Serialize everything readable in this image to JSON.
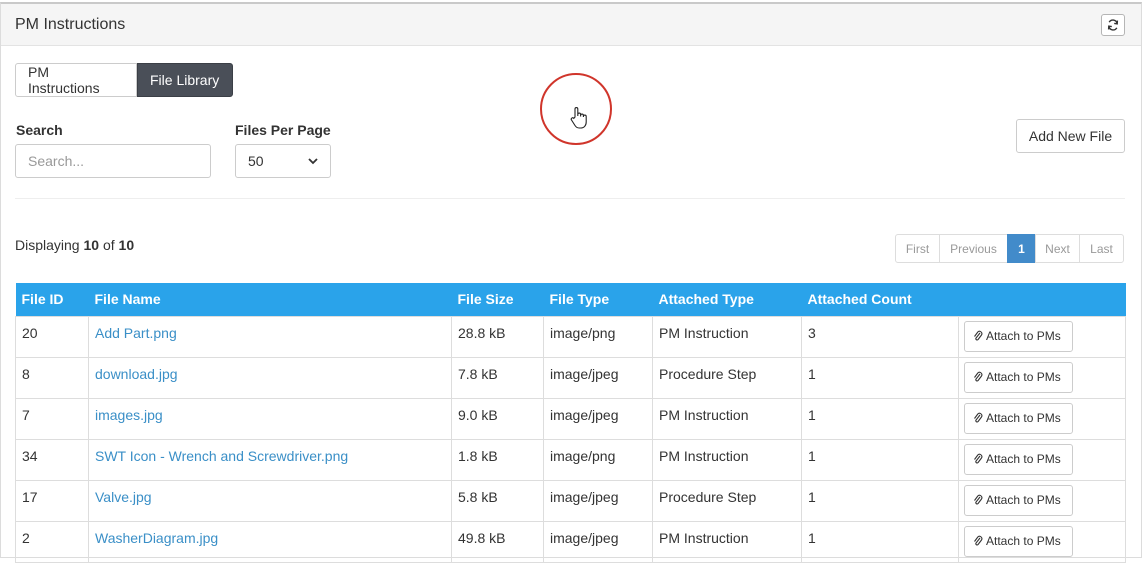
{
  "panel": {
    "title": "PM Instructions",
    "refresh_icon": "refresh-icon"
  },
  "tabs": [
    {
      "label": "PM Instructions",
      "active": false
    },
    {
      "label": "File Library",
      "active": true
    }
  ],
  "search": {
    "label": "Search",
    "placeholder": "Search...",
    "value": ""
  },
  "files_per_page": {
    "label": "Files Per Page",
    "selected": "50"
  },
  "add_new_file_label": "Add New File",
  "displaying": {
    "prefix": "Displaying",
    "shown": "10",
    "of": "of",
    "total": "10"
  },
  "pagination": {
    "first": "First",
    "previous": "Previous",
    "current": "1",
    "next": "Next",
    "last": "Last"
  },
  "table": {
    "columns": [
      "File ID",
      "File Name",
      "File Size",
      "File Type",
      "Attached Type",
      "Attached Count",
      ""
    ],
    "action_label": "Attach to PMs",
    "rows": [
      {
        "id": "20",
        "name": "Add Part.png",
        "size": "28.8 kB",
        "type": "image/png",
        "attached_type": "PM Instruction",
        "count": "3"
      },
      {
        "id": "8",
        "name": "download.jpg",
        "size": "7.8 kB",
        "type": "image/jpeg",
        "attached_type": "Procedure Step",
        "count": "1"
      },
      {
        "id": "7",
        "name": "images.jpg",
        "size": "9.0 kB",
        "type": "image/jpeg",
        "attached_type": "PM Instruction",
        "count": "1"
      },
      {
        "id": "34",
        "name": "SWT Icon - Wrench and Screwdriver.png",
        "size": "1.8 kB",
        "type": "image/png",
        "attached_type": "PM Instruction",
        "count": "1"
      },
      {
        "id": "17",
        "name": "Valve.jpg",
        "size": "5.8 kB",
        "type": "image/jpeg",
        "attached_type": "Procedure Step",
        "count": "1"
      },
      {
        "id": "2",
        "name": "WasherDiagram.jpg",
        "size": "49.8 kB",
        "type": "image/jpeg",
        "attached_type": "PM Instruction",
        "count": "1"
      }
    ]
  },
  "colors": {
    "header_bg": "#2aa3ea",
    "link": "#3a8fc7",
    "active_tab": "#4a4f58",
    "pagination_active": "#428bca",
    "cursor_ring": "#d0352b"
  }
}
